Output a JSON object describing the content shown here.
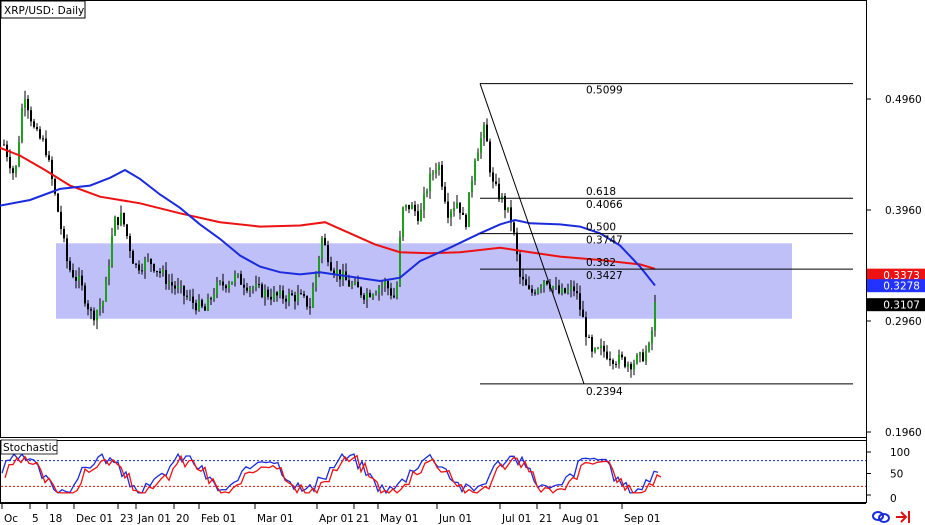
{
  "chart_data": [
    {
      "type": "candlestick",
      "title": "XRP/USD: Daily",
      "ylim": [
        0.19,
        0.53
      ],
      "ytick_values": [
        0.196,
        0.296,
        0.396,
        0.496
      ],
      "ytick_labels": [
        "0.1960",
        "0.2960",
        "0.3960",
        "0.4960"
      ],
      "xtick_labels": [
        "Oc",
        "5",
        "18",
        "Dec 01",
        "23",
        "Jan 01",
        "20",
        "Feb 01",
        "Mar 01",
        "Apr 01",
        "21",
        "May 01",
        "Jun 01",
        "Jul 01",
        "21",
        "Aug 01",
        "Sep 01"
      ],
      "price_badges": [
        {
          "label": "0.3373",
          "value": 0.3373,
          "bg": "#ee1111",
          "fg": "#ffffff"
        },
        {
          "label": "0.3278",
          "value": 0.3278,
          "bg": "#2233ff",
          "fg": "#ffffff"
        },
        {
          "label": "0.3107",
          "value": 0.3107,
          "bg": "#000000",
          "fg": "#ffffff"
        }
      ],
      "fibonacci": {
        "high": 0.5099,
        "low": 0.2394,
        "levels": [
          {
            "ratio": "",
            "value": "0.5099",
            "price": 0.5099
          },
          {
            "ratio": "0.618",
            "value": "0.4066",
            "price": 0.4066
          },
          {
            "ratio": "0.500",
            "value": "0.3747",
            "price": 0.3747
          },
          {
            "ratio": "0.382",
            "value": "0.3427",
            "price": 0.3427
          },
          {
            "ratio": "",
            "value": "0.2394",
            "price": 0.2394
          }
        ]
      },
      "range_box": {
        "top": 0.366,
        "bottom": 0.298
      },
      "ma_slow_color": "#ee1111",
      "ma_fast_color": "#1a2bdd",
      "bull_color": "#1f9e1f",
      "bear_color": "#000000"
    },
    {
      "type": "line",
      "title": "Stochastic",
      "ylim": [
        0,
        100
      ],
      "ytick_labels": [
        "0",
        "50",
        "100"
      ],
      "levels": [
        80,
        20
      ],
      "series_colors": [
        "#1a2bdd",
        "#ee1111"
      ]
    }
  ],
  "footer": {
    "icon1": "link-icon",
    "icon2": "arrow-icon"
  }
}
